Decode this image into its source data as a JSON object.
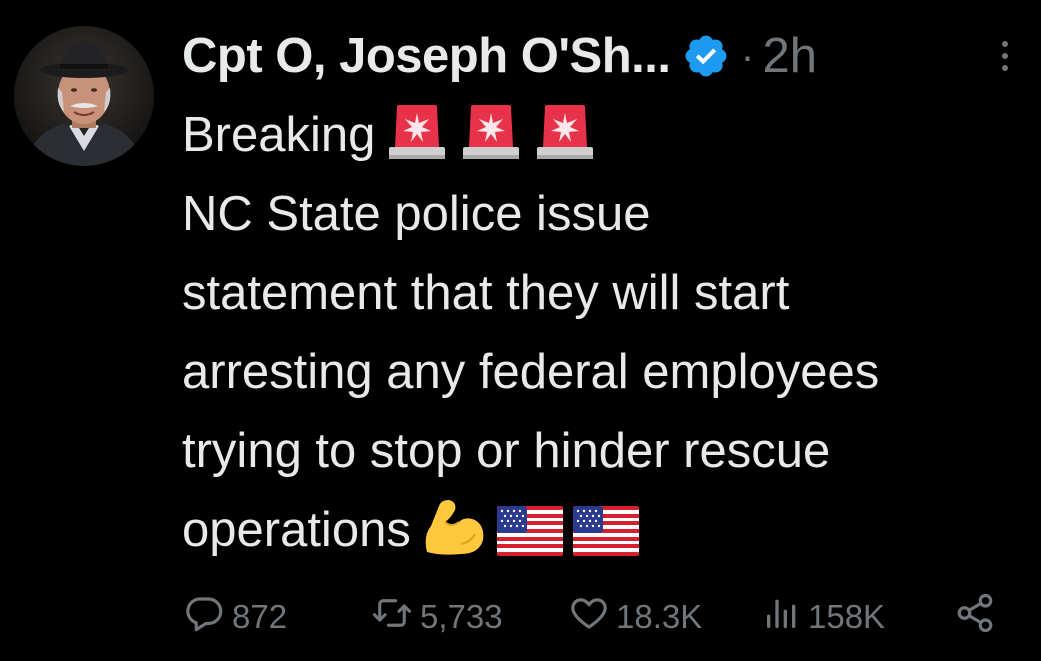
{
  "author": {
    "display_name": "Cpt O, Joseph O'Sh...",
    "verified": true,
    "separator": "·",
    "timestamp": "2h"
  },
  "tweet": {
    "line1": "Breaking",
    "line1_emojis": [
      "police-light-emoji",
      "police-light-emoji",
      "police-light-emoji"
    ],
    "line2": "NC State police issue",
    "line3": "statement that they will start",
    "line4": "arresting any federal employees",
    "line5": "trying to stop or hinder rescue",
    "line6": "operations",
    "line6_emojis": [
      "flexed-biceps-emoji",
      "us-flag-emoji",
      "us-flag-emoji"
    ]
  },
  "actions": {
    "replies": "872",
    "retweets": "5,733",
    "likes": "18.3K",
    "views": "158K"
  },
  "colors": {
    "background": "#000000",
    "text": "#e7e9ea",
    "muted": "#71767b",
    "verified": "#1d9bf0"
  }
}
